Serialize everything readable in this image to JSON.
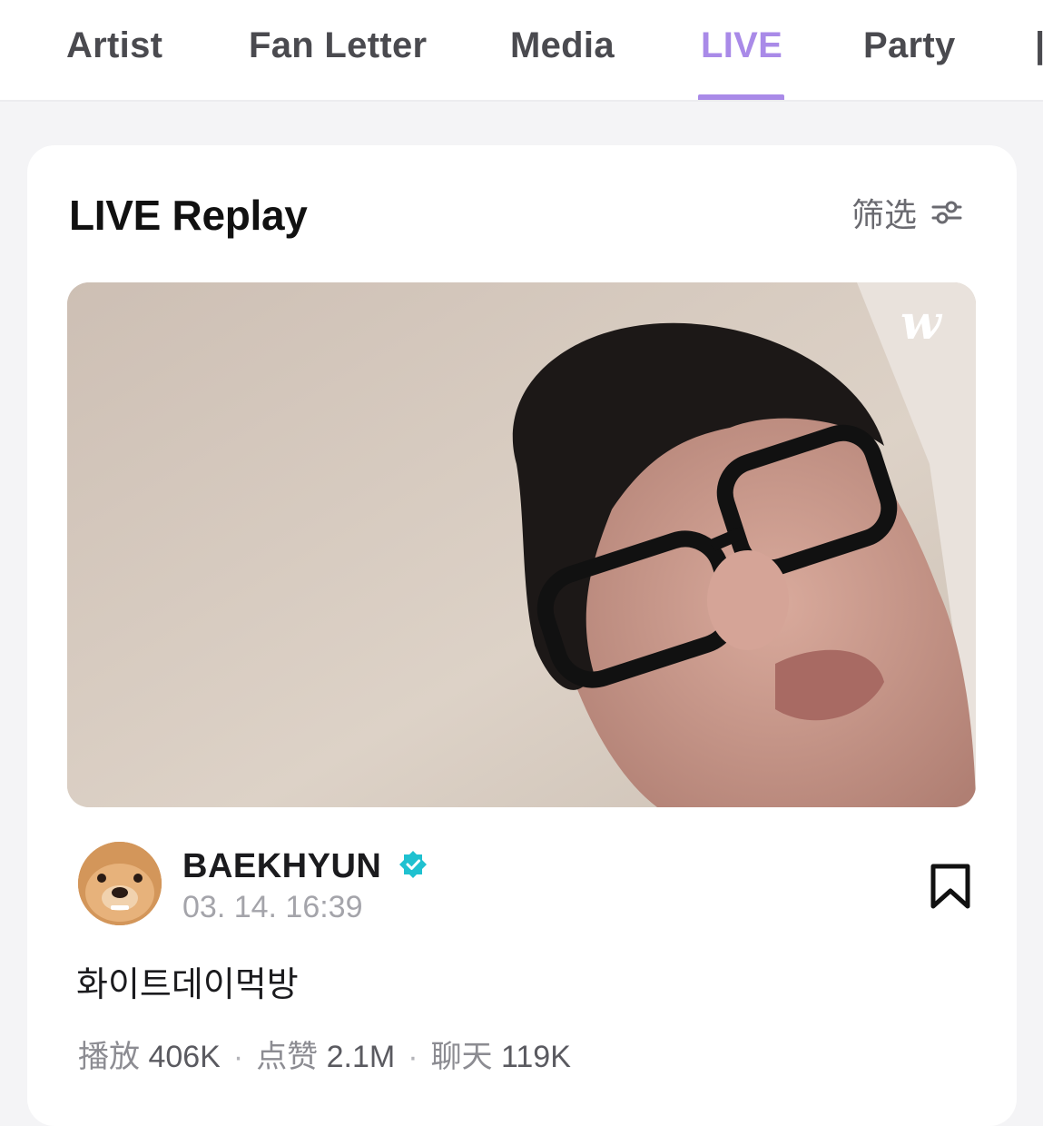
{
  "nav": {
    "tabs": [
      {
        "label": "Artist",
        "active": false
      },
      {
        "label": "Fan Letter",
        "active": false
      },
      {
        "label": "Media",
        "active": false
      },
      {
        "label": "LIVE",
        "active": true
      },
      {
        "label": "Party",
        "active": false
      }
    ],
    "accent_color": "#a98ae8"
  },
  "section": {
    "title": "LIVE Replay",
    "filter_label": "筛选",
    "filter_icon": "sliders-icon"
  },
  "live": {
    "thumbnail_watermark": "w",
    "artist_name": "BAEKHYUN",
    "verified_icon": "verified-badge-icon",
    "verified_color": "#1fc1d0",
    "date": "03. 14. 16:39",
    "title": "화이트데이먹방",
    "bookmark_icon": "bookmark-icon",
    "stats": {
      "plays_label": "播放",
      "plays_value": "406K",
      "likes_label": "点赞",
      "likes_value": "2.1M",
      "chats_label": "聊天",
      "chats_value": "119K",
      "separator": "·"
    }
  }
}
